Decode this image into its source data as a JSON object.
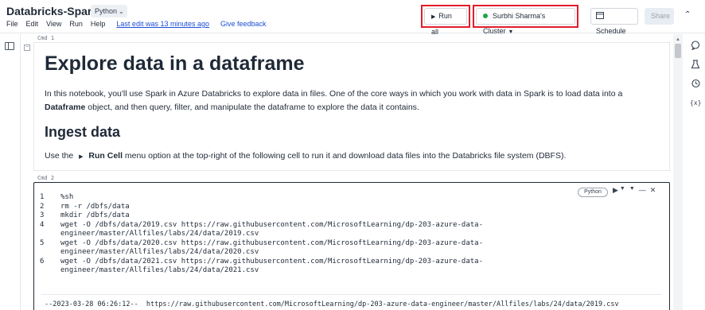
{
  "header": {
    "title": "Databricks-Spark",
    "language": "Python",
    "menu": [
      "File",
      "Edit",
      "View",
      "Run",
      "Help"
    ],
    "last_edit": "Last edit was 13 minutes ago",
    "feedback": "Give feedback",
    "run_all": "Run all",
    "cluster": "Surbhi Sharma's Cluster",
    "schedule": "Schedule",
    "share": "Share"
  },
  "cells": [
    {
      "label": "Cmd 1",
      "heading": "Explore data in a dataframe",
      "para_a": "In this notebook, you'll use Spark in Azure Databricks to explore data in files. One of the core ways in which you work with data in Spark is to load data into a",
      "para_b_bold": "Dataframe",
      "para_b": " object, and then query, filter, and manipulate the dataframe to explore the data it contains.",
      "subheading": "Ingest data",
      "instr_pre": "Use the",
      "instr_bold": "Run Cell",
      "instr_post": " menu option at the top-right of the following cell to run it and download data files into the Databricks file system (DBFS)."
    },
    {
      "label": "Cmd 2",
      "language": "Python",
      "lines": [
        {
          "n": "1",
          "text": "%sh"
        },
        {
          "n": "2",
          "text": "rm -r /dbfs/data"
        },
        {
          "n": "3",
          "text": "mkdir /dbfs/data"
        },
        {
          "n": "4",
          "text": "wget -O /dbfs/data/2019.csv https://raw.githubusercontent.com/MicrosoftLearning/dp-203-azure-data-"
        },
        {
          "n": "",
          "text": "engineer/master/Allfiles/labs/24/data/2019.csv"
        },
        {
          "n": "5",
          "text": "wget -O /dbfs/data/2020.csv https://raw.githubusercontent.com/MicrosoftLearning/dp-203-azure-data-"
        },
        {
          "n": "",
          "text": "engineer/master/Allfiles/labs/24/data/2020.csv"
        },
        {
          "n": "6",
          "text": "wget -O /dbfs/data/2021.csv https://raw.githubusercontent.com/MicrosoftLearning/dp-203-azure-data-"
        },
        {
          "n": "",
          "text": "engineer/master/Allfiles/labs/24/data/2021.csv"
        }
      ],
      "output": "--2023-03-28 06:26:12--  https://raw.githubusercontent.com/MicrosoftLearning/dp-203-azure-data-engineer/master/Allfiles/labs/24/data/2019.csv"
    }
  ],
  "icons": {
    "toc": "table-of-contents-icon",
    "comments": "comment-icon",
    "experiment": "flask-icon",
    "revision": "history-icon",
    "variables": "variables-icon"
  },
  "colors": {
    "highlight": "#e11d2a",
    "cluster_status": "#22a34a",
    "link": "#1d4ed8"
  }
}
